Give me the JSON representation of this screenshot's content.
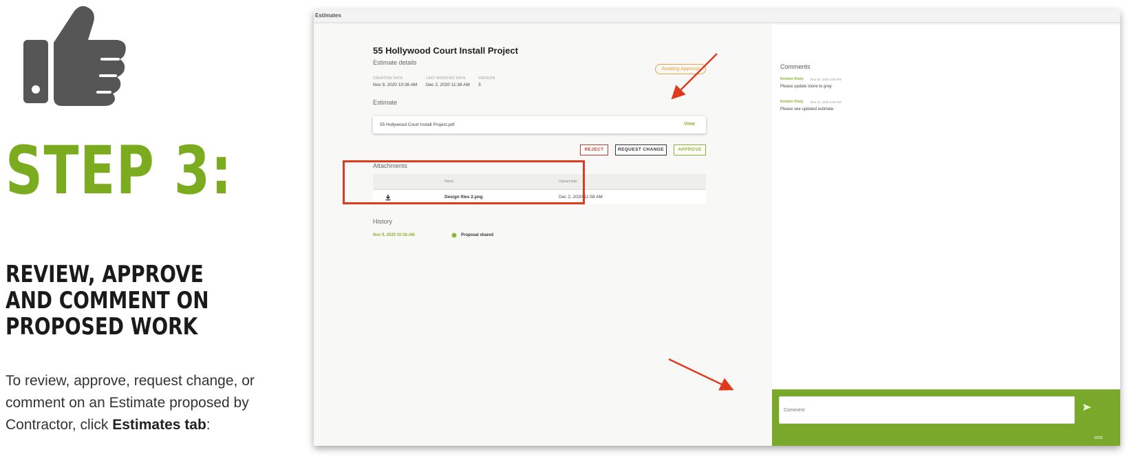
{
  "tutorial": {
    "step": "STEP 3:",
    "heading": "REVIEW, APPROVE AND COMMENT ON PROPOSED WORK",
    "instruction_prefix": "To review, approve, request change, or comment on an Estimate proposed by Contractor, click ",
    "instruction_bold": "Estimates tab",
    "instruction_suffix": ":"
  },
  "app": {
    "tab_label": "Estimates",
    "project_title": "55 Hollywood Court Install Project",
    "estimate_details_label": "Estimate details",
    "status_badge": "Awaiting Approval",
    "meta": {
      "creation_date_label": "CREATION DATE",
      "creation_date": "Nov 9, 2020 10:36 AM",
      "last_modified_label": "LAST MODIFIED DATE",
      "last_modified": "Dec 2, 2020 11:38 AM",
      "version_label": "VERSION",
      "version": "3"
    },
    "estimate_label": "Estimate",
    "estimate_file": "55 Hollywood Court Install Project.pdf",
    "view_link": "View",
    "buttons": {
      "reject": "REJECT",
      "request_change": "REQUEST CHANGE",
      "approve": "APPROVE"
    },
    "attachments": {
      "label": "Attachments",
      "col_name": "Name",
      "col_upload_date": "Upload date",
      "rows": [
        {
          "name": "Design files 2.png",
          "date": "Dec 2, 2020 11:58 AM",
          "icon": "download-icon"
        }
      ]
    },
    "history": {
      "label": "History",
      "entries": [
        {
          "date": "Nov 9, 2020 10:36 AM",
          "text": "Proposal shared"
        }
      ]
    },
    "comments": {
      "label": "Comments",
      "items": [
        {
          "author": "Kristen Kiely",
          "time": "Nov 10, 2020 2:36 PM",
          "text": "Please update stone to gray"
        },
        {
          "author": "Kristen Kiely",
          "time": "Nov 11, 2020 3:04 PM",
          "text": "Please see updated estimate"
        }
      ],
      "input_placeholder": "Comment",
      "char_count": "0/255"
    }
  },
  "colors": {
    "brand_green": "#7bab1f",
    "reject_red": "#c0392b",
    "status_orange": "#e8a53a",
    "annotation_red": "#e03a1e"
  }
}
